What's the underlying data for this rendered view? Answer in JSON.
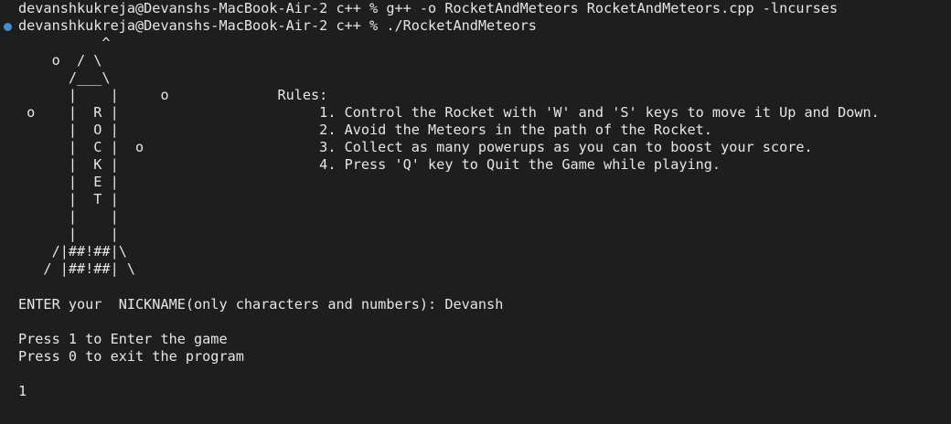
{
  "terminal": {
    "compile_prompt": "devanshkukreja@Devanshs-MacBook-Air-2 c++ % ",
    "compile_command": "g++ -o RocketAndMeteors RocketAndMeteors.cpp -lncurses",
    "run_prompt": "devanshkukreja@Devanshs-MacBook-Air-2 c++ % ",
    "run_command": "./RocketAndMeteors",
    "marker_color": "#3e8ed0"
  },
  "game_screen": {
    "ascii_art": "          ^\n    o  / \\\n      /___\\\n      |    |     o             Rules:\n o    |  R |                        1. Control the Rocket with 'W' and 'S' keys to move it Up and Down.\n      |  O |                        2. Avoid the Meteors in the path of the Rocket.\n      |  C |  o                     3. Collect as many powerups as you can to boost your score.\n      |  K |                        4. Press 'Q' key to Quit the Game while playing.\n      |  E |\n      |  T |\n      |    |\n      |    |\n    /|##!##|\\\n   / |##!##| \\",
    "nickname_prompt": "ENTER your  NICKNAME(only characters and numbers): ",
    "nickname_value": "Devansh",
    "menu_option_enter": "Press 1 to Enter the game",
    "menu_option_exit": "Press 0 to exit the program",
    "user_choice": "1"
  }
}
